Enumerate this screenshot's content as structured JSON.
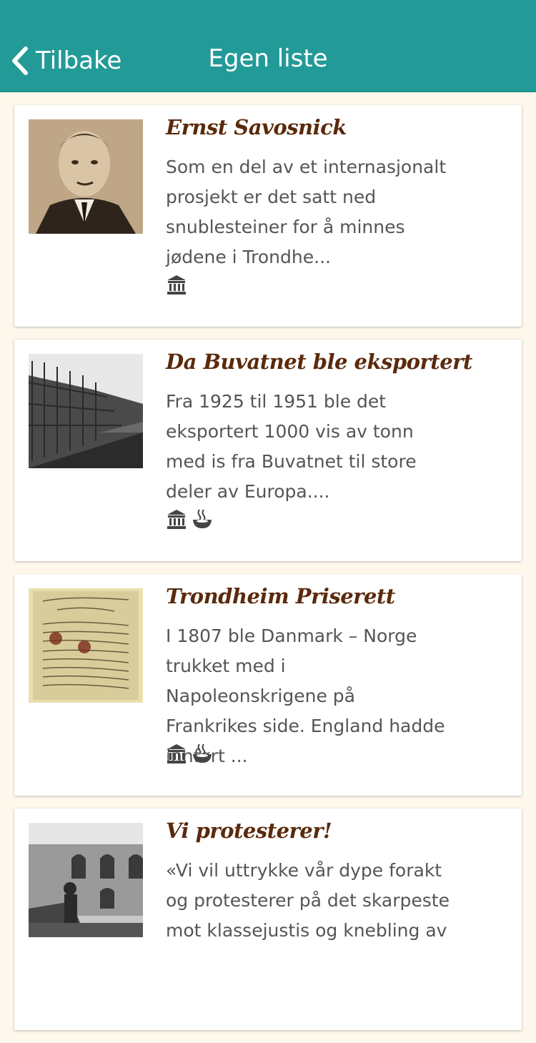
{
  "header": {
    "back_label": "Tilbake",
    "title": "Egen liste"
  },
  "items": [
    {
      "title": "Ernst Savosnick",
      "text": "Som en del av et internasjonalt prosjekt er det satt ned snublesteiner for å minnes jødene i Trondhe...",
      "icons": [
        "museum-icon"
      ]
    },
    {
      "title": "Da Buvatnet ble eksportert",
      "text": "Fra 1925 til 1951 ble det eksportert 1000 vis av tonn med is fra Buvatnet til store deler av Europa....",
      "icons": [
        "museum-icon",
        "food-bowl-icon"
      ]
    },
    {
      "title": "Trondheim Priserett",
      "text": "I 1807 ble Danmark – Norge trukket med i Napoleonskrigene på Frankrikes side. England hadde innført ...",
      "icons": [
        "museum-icon",
        "food-bowl-icon"
      ]
    },
    {
      "title": "Vi protesterer!",
      "text": "«Vi vil uttrykke vår dype forakt og protesterer på det skarpeste mot klassejustis og knebling av",
      "icons": []
    }
  ]
}
